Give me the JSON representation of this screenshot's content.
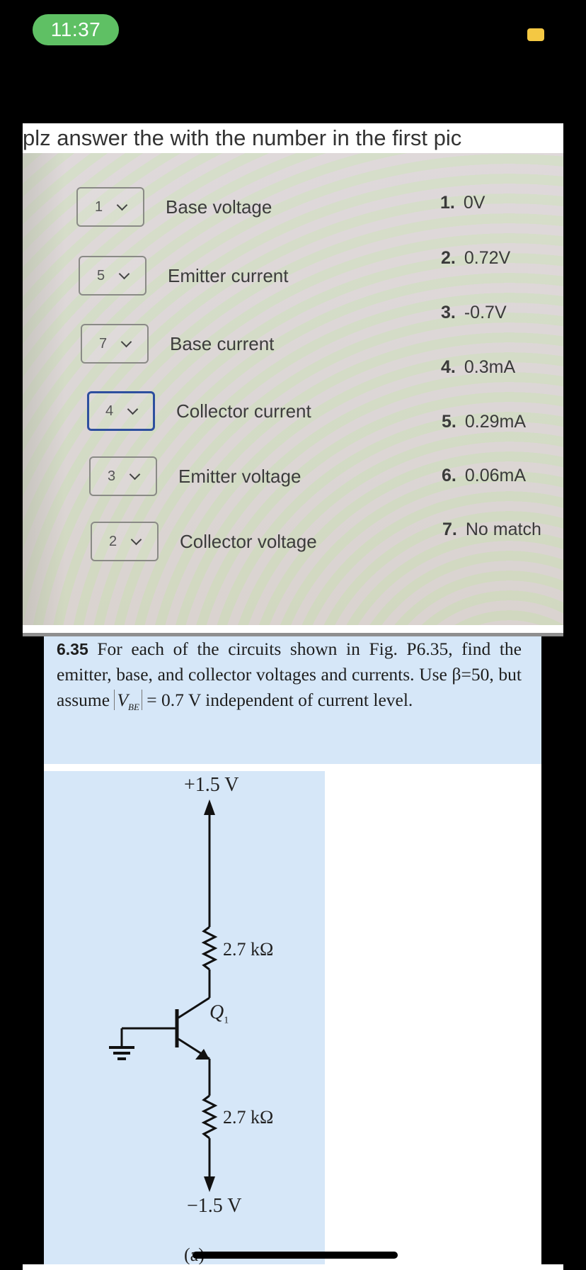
{
  "status_bar": {
    "time": "11:37",
    "indicator_color": "#f4c843",
    "time_pill_color": "#5fc064"
  },
  "message": {
    "caption": "plz answer the with the number  in the first pic"
  },
  "quiz": {
    "rows": [
      {
        "selected": "1",
        "label": "Base voltage",
        "focused": false
      },
      {
        "selected": "5",
        "label": "Emitter current",
        "focused": false
      },
      {
        "selected": "7",
        "label": "Base current",
        "focused": false
      },
      {
        "selected": "4",
        "label": "Collector current",
        "focused": true
      },
      {
        "selected": "3",
        "label": "Emitter voltage",
        "focused": false
      },
      {
        "selected": "2",
        "label": "Collector voltage",
        "focused": false
      }
    ],
    "options": [
      {
        "num": "1.",
        "value": "0V"
      },
      {
        "num": "2.",
        "value": "0.72V"
      },
      {
        "num": "3.",
        "value": "-0.7V"
      },
      {
        "num": "4.",
        "value": "0.3mA"
      },
      {
        "num": "5.",
        "value": "0.29mA"
      },
      {
        "num": "6.",
        "value": "0.06mA"
      },
      {
        "num": "7.",
        "value": "No match"
      }
    ],
    "focus_color": "#2d4f9e"
  },
  "problem": {
    "number": "6.35",
    "text_part1": " For each of the circuits shown in Fig. P6.35, find the emitter, base, and collector voltages and currents. Use β=50, but assume ",
    "abs_symbol": "V",
    "abs_subscript": "BE",
    "text_part2": " = 0.7 V independent of current level."
  },
  "circuit": {
    "supply_top": "+1.5 V",
    "supply_bottom": "−1.5 V",
    "rc": "2.7 kΩ",
    "re": "2.7 kΩ",
    "transistor": "Q",
    "transistor_sub": "1",
    "figure_label": "(a)"
  }
}
